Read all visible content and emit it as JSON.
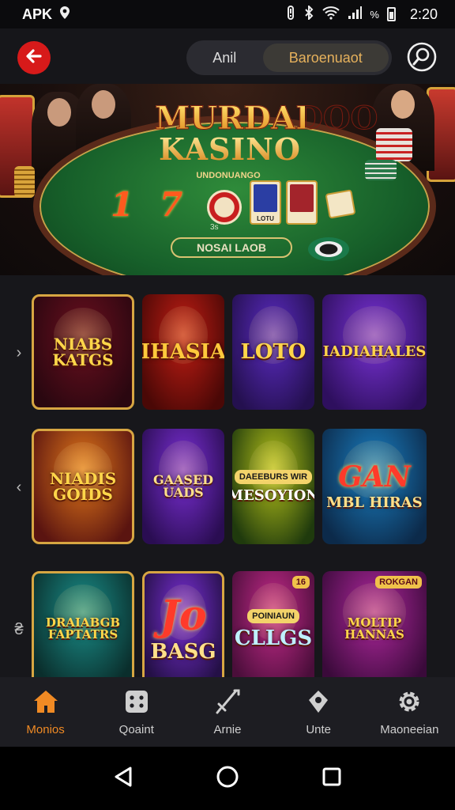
{
  "status_bar": {
    "carrier": "APK",
    "time": "2:20",
    "battery_text": "%"
  },
  "app_bar": {
    "back_icon": "arrow-left-icon",
    "segments": [
      "Anil",
      "Baroenuaot"
    ],
    "selected_segment": 1,
    "search_icon": "search-icon",
    "accent_color": "#d71a1a"
  },
  "banner": {
    "title_line1": "MURDADOO",
    "title_line2": "KASINO",
    "subtitle": "UNDONUANGO",
    "numbers": [
      "1",
      "7"
    ],
    "card_labels": [
      "LOTU",
      ""
    ],
    "small_text": "3s",
    "bet_label": "NOSAI LAOB"
  },
  "games": {
    "rows": [
      {
        "arrow": "›",
        "tiles": [
          {
            "title": "NIABS KATGS",
            "colors": [
              "#6a0f1e",
              "#2a0710"
            ],
            "text_color": "#ffd64a",
            "gold_border": true
          },
          {
            "title": "IHASIA",
            "colors": [
              "#c11d14",
              "#4a0806"
            ],
            "text_color": "#ffc93c",
            "gold_border": false
          },
          {
            "title": "LOTO",
            "colors": [
              "#5b2bc2",
              "#24104f"
            ],
            "text_color": "#ffd64a",
            "gold_border": false
          },
          {
            "title": "IADIAHALES",
            "colors": [
              "#7a33d8",
              "#2e0f5e"
            ],
            "text_color": "#ffd64a",
            "gold_border": false
          }
        ]
      },
      {
        "arrow": "‹",
        "tiles": [
          {
            "title": "NIADIS GOIDS",
            "colors": [
              "#e2781a",
              "#5a1410"
            ],
            "text_color": "#ffd64a",
            "gold_border": true
          },
          {
            "title": "GAASED UADS",
            "colors": [
              "#7b2fd6",
              "#2a0d52"
            ],
            "text_color": "#ffe08a",
            "gold_border": false
          },
          {
            "title": "MESOYION",
            "colors": [
              "#b6c21a",
              "#1f3a0d"
            ],
            "text_color": "#ffffff",
            "gold_border": false,
            "badge": "DAEEBURS WIR"
          },
          {
            "title": "MBL HIRAS",
            "colors": [
              "#1a7fc2",
              "#0c2a4a"
            ],
            "text_color": "#ffe08a",
            "gold_border": false,
            "headline": "GAN"
          }
        ]
      },
      {
        "arrow": "₴",
        "tiles": [
          {
            "title": "DRAIABGB FAPTATRS",
            "colors": [
              "#1a8f8a",
              "#0a2e2c"
            ],
            "text_color": "#ffd64a",
            "gold_border": true
          },
          {
            "title": "BASG",
            "colors": [
              "#7a2fd6",
              "#241046"
            ],
            "text_color": "#ffe08a",
            "gold_border": true,
            "headline": "Jo"
          },
          {
            "title": "CLLGS",
            "colors": [
              "#c42a8a",
              "#4a0e3a"
            ],
            "text_color": "#bff0ff",
            "gold_border": false,
            "badge": "POINIAUN",
            "corner": "16"
          },
          {
            "title": "MOLTIP HANNAS",
            "colors": [
              "#b0289e",
              "#3a0a3a"
            ],
            "text_color": "#ffd64a",
            "gold_border": false,
            "corner": "ROKGAN"
          }
        ]
      }
    ]
  },
  "bottom_nav": {
    "items": [
      {
        "label": "Monios",
        "icon": "home-icon",
        "active": true
      },
      {
        "label": "Qoaint",
        "icon": "dice-icon",
        "active": false
      },
      {
        "label": "Arnie",
        "icon": "sword-icon",
        "active": false
      },
      {
        "label": "Unte",
        "icon": "badge-icon",
        "active": false
      },
      {
        "label": "Maoneeian",
        "icon": "gear-icon",
        "active": false
      }
    ],
    "active_color": "#f08a24"
  },
  "system_nav": {
    "back_icon": "triangle-back-icon",
    "home_icon": "circle-home-icon",
    "recents_icon": "square-recents-icon"
  }
}
